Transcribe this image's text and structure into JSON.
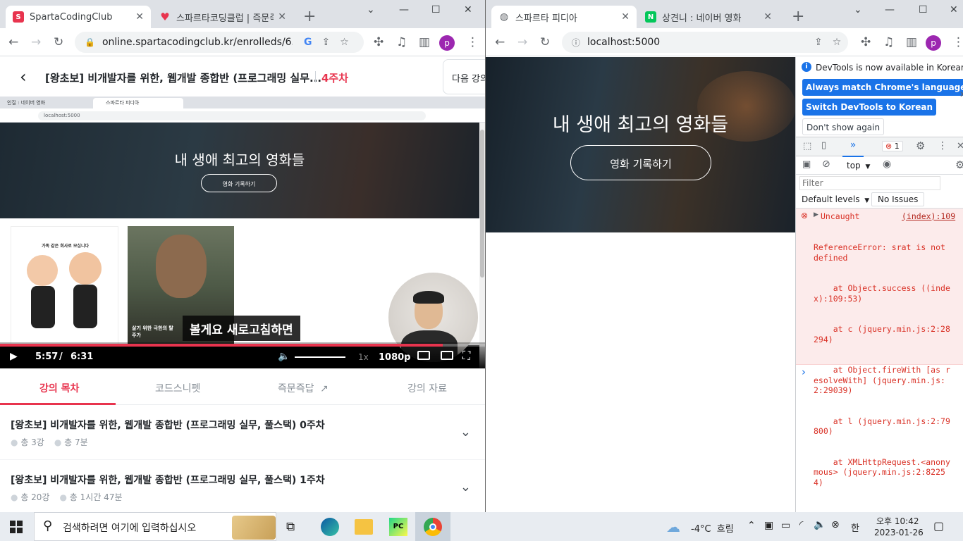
{
  "left_window": {
    "tabs": [
      {
        "title": "SpartaCodingClub",
        "active": true
      },
      {
        "title": "스파르타코딩클럽 | 즉문즉",
        "active": false
      }
    ],
    "url": "online.spartacodingclub.kr/enrolleds/63a..."
  },
  "right_window": {
    "tabs": [
      {
        "title": "스파르타 피디아",
        "active": true
      },
      {
        "title": "상견니 : 네이버 영화",
        "active": false
      }
    ],
    "url": "localhost:5000"
  },
  "lecture": {
    "title": "[왕초보] 비개발자를 위한, 웹개발 종합반 (프로그래밍 실무...",
    "week": "4주차",
    "next_label": "다음 강의"
  },
  "video": {
    "inner_tabs": [
      "인질 : 네이버 영화",
      "스파르타 피디아"
    ],
    "inner_url": "localhost:5000",
    "hero_title": "내 생애 최고의 영화들",
    "hero_button": "영화 기록하기",
    "poster1_text": "가족 같은 회사로 모십니다",
    "poster2_text": "살기 위한 극한의 탈주가",
    "subtitle": "볼게요 새로고침하면",
    "time_current": "5:57",
    "time_sep": "/",
    "time_total": "6:31",
    "speed": "1x",
    "quality": "1080p",
    "progress": 0.913
  },
  "content_tabs": [
    "강의 목차",
    "코드스니펫",
    "즉문즉답",
    "강의 자료"
  ],
  "weeks": [
    {
      "title": "[왕초보] 비개발자를 위한, 웹개발 종합반 (프로그래밍 실무, 풀스택) 0주차",
      "lectures": "총 3강",
      "duration": "총 7분"
    },
    {
      "title": "[왕초보] 비개발자를 위한, 웹개발 종합반 (프로그래밍 실무, 풀스택) 1주차",
      "lectures": "총 20강",
      "duration": "총 1시간 47분"
    }
  ],
  "page": {
    "hero_title": "내 생애 최고의 영화들",
    "hero_button": "영화 기록하기"
  },
  "devtools": {
    "notice": "DevTools is now available in Korean!",
    "btn_match": "Always match Chrome's language",
    "btn_switch": "Switch DevTools to Korean",
    "btn_dont": "Don't show again",
    "more_tabs": "»",
    "error_count": "1",
    "context": "top",
    "filter_placeholder": "Filter",
    "levels": "Default levels",
    "issues": "No Issues",
    "error_source": "(index):109",
    "error_lines": [
      "Uncaught",
      "ReferenceError: srat is not defined",
      "    at Object.success ((index):109:53)",
      "    at c (jquery.min.js:2:28294)",
      "    at Object.fireWith [as resolveWith] (jquery.min.js:2:29039)",
      "    at l (jquery.min.js:2:79800)",
      "    at XMLHttpRequest.<anonymous> (jquery.min.js:2:82254)"
    ],
    "prompt": "›"
  },
  "taskbar": {
    "search_placeholder": "검색하려면 여기에 입력하십시오",
    "weather": "-4°C  흐림",
    "ime": "한",
    "time": "오후 10:42",
    "date": "2023-01-26"
  },
  "colors": {
    "accent_red": "#e8344e",
    "chrome_blue": "#1a73e8",
    "error_red": "#d93025"
  }
}
